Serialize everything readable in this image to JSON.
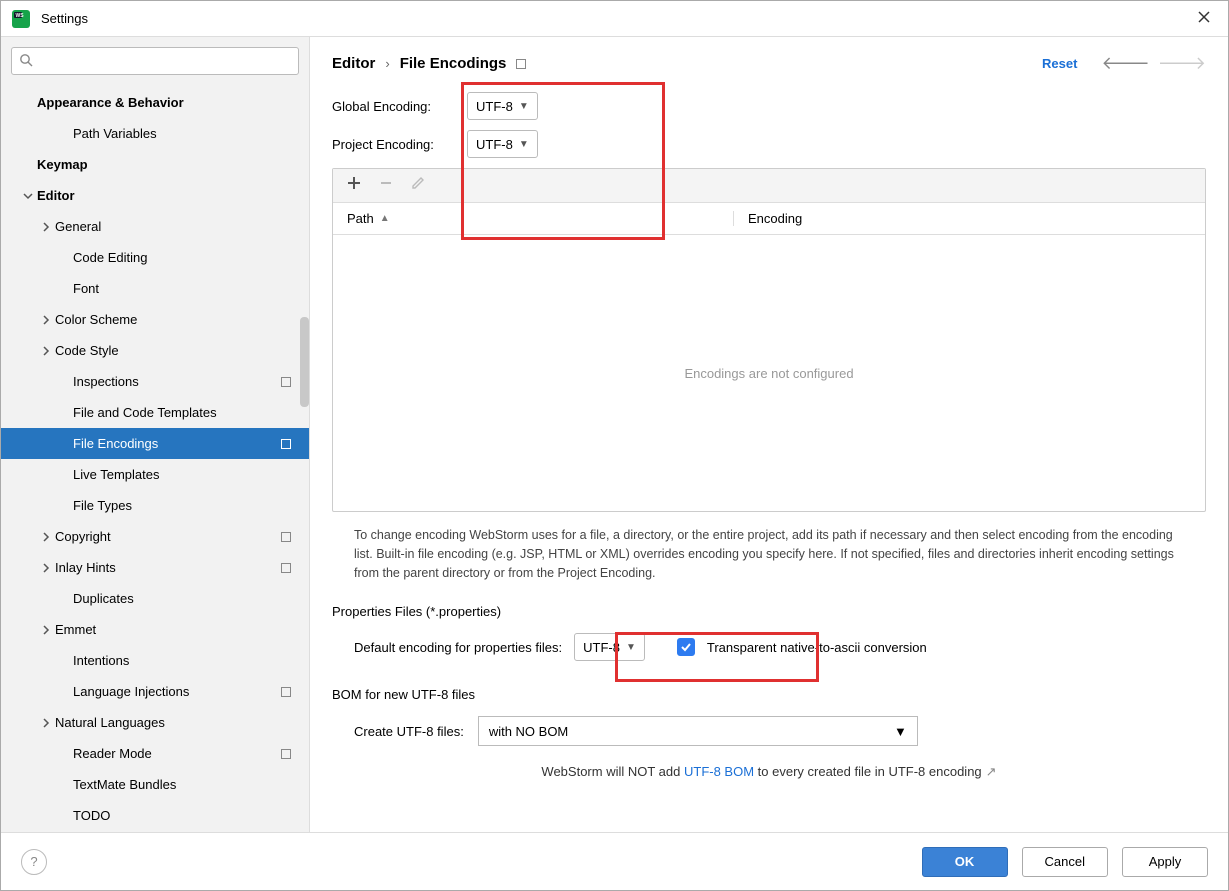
{
  "window": {
    "title": "Settings"
  },
  "search": {
    "placeholder": ""
  },
  "sidebar": {
    "items": [
      {
        "label": "Appearance & Behavior",
        "bold": true,
        "indent": 0,
        "chev": ""
      },
      {
        "label": "Path Variables",
        "indent": 2
      },
      {
        "label": "Keymap",
        "bold": true,
        "indent": 0
      },
      {
        "label": "Editor",
        "bold": true,
        "indent": 0,
        "chev": "v"
      },
      {
        "label": "General",
        "indent": 1,
        "chev": ">"
      },
      {
        "label": "Code Editing",
        "indent": 2
      },
      {
        "label": "Font",
        "indent": 2
      },
      {
        "label": "Color Scheme",
        "indent": 1,
        "chev": ">"
      },
      {
        "label": "Code Style",
        "indent": 1,
        "chev": ">"
      },
      {
        "label": "Inspections",
        "indent": 2,
        "badge": true
      },
      {
        "label": "File and Code Templates",
        "indent": 2
      },
      {
        "label": "File Encodings",
        "indent": 2,
        "badge": true,
        "selected": true
      },
      {
        "label": "Live Templates",
        "indent": 2
      },
      {
        "label": "File Types",
        "indent": 2
      },
      {
        "label": "Copyright",
        "indent": 1,
        "chev": ">",
        "badge": true
      },
      {
        "label": "Inlay Hints",
        "indent": 1,
        "chev": ">",
        "badge": true
      },
      {
        "label": "Duplicates",
        "indent": 2
      },
      {
        "label": "Emmet",
        "indent": 1,
        "chev": ">"
      },
      {
        "label": "Intentions",
        "indent": 2
      },
      {
        "label": "Language Injections",
        "indent": 2,
        "badge": true
      },
      {
        "label": "Natural Languages",
        "indent": 1,
        "chev": ">"
      },
      {
        "label": "Reader Mode",
        "indent": 2,
        "badge": true
      },
      {
        "label": "TextMate Bundles",
        "indent": 2
      },
      {
        "label": "TODO",
        "indent": 2
      }
    ]
  },
  "breadcrumb": {
    "root": "Editor",
    "page": "File Encodings",
    "reset": "Reset"
  },
  "form": {
    "global_label": "Global Encoding:",
    "global_value": "UTF-8",
    "project_label": "Project Encoding:",
    "project_value": "UTF-8"
  },
  "table": {
    "col_path": "Path",
    "col_encoding": "Encoding",
    "empty": "Encodings are not configured"
  },
  "help": "To change encoding WebStorm uses for a file, a directory, or the entire project, add its path if necessary and then select encoding from the encoding list. Built-in file encoding (e.g. JSP, HTML or XML) overrides encoding you specify here. If not specified, files and directories inherit encoding settings from the parent directory or from the Project Encoding.",
  "properties": {
    "section": "Properties Files (*.properties)",
    "label": "Default encoding for properties files:",
    "value": "UTF-8",
    "checkbox_label": "Transparent native-to-ascii conversion"
  },
  "bom": {
    "section": "BOM for new UTF-8 files",
    "label": "Create UTF-8 files:",
    "value": "with NO BOM",
    "note_pre": "WebStorm will NOT add ",
    "note_link": "UTF-8 BOM",
    "note_post": " to every created file in UTF-8 encoding"
  },
  "footer": {
    "ok": "OK",
    "cancel": "Cancel",
    "apply": "Apply"
  }
}
